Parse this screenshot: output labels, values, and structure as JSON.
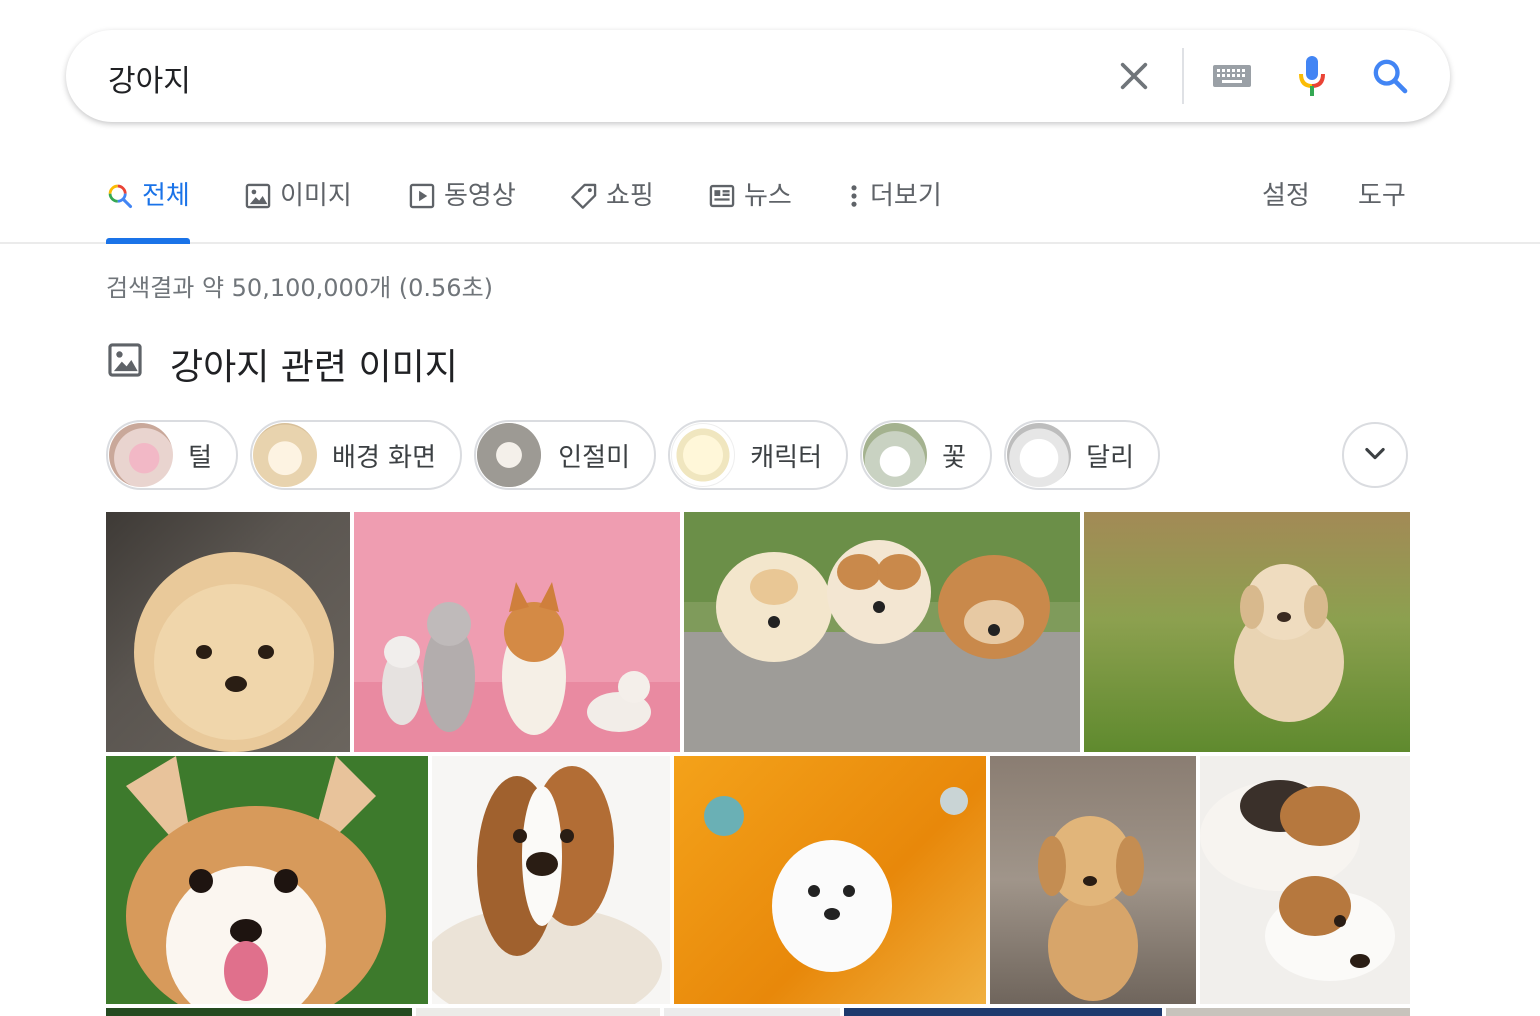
{
  "search": {
    "query": "강아지"
  },
  "icons": {
    "clear": "close-icon",
    "keyboard": "keyboard-icon",
    "mic": "microphone-icon",
    "search": "search-icon"
  },
  "tabs": [
    {
      "label": "전체",
      "icon": "search-icon",
      "active": true
    },
    {
      "label": "이미지",
      "icon": "image-icon",
      "active": false
    },
    {
      "label": "동영상",
      "icon": "play-icon",
      "active": false
    },
    {
      "label": "쇼핑",
      "icon": "tag-icon",
      "active": false
    },
    {
      "label": "뉴스",
      "icon": "news-icon",
      "active": false
    },
    {
      "label": "더보기",
      "icon": "more-vert-icon",
      "active": false
    }
  ],
  "tools": {
    "settings": "설정",
    "tools": "도구"
  },
  "stats": "검색결과 약 50,100,000개 (0.56초)",
  "images_section": {
    "title": "강아지 관련 이미지",
    "chips": [
      "털",
      "배경 화면",
      "인절미",
      "캐릭터",
      "꽃",
      "달리"
    ]
  },
  "colors": {
    "accent": "#1a73e8",
    "text_secondary": "#5f6368",
    "border": "#dadce0",
    "google_red": "#ea4335",
    "google_yellow": "#fbbc04",
    "google_green": "#34a853"
  }
}
